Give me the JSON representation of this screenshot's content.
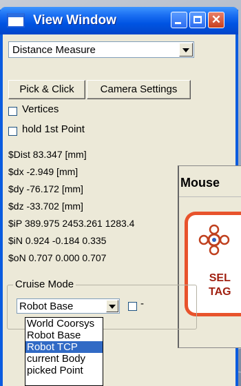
{
  "window": {
    "title": "View Window",
    "buttons": {
      "minimize_icon": "minimize-icon",
      "maximize_icon": "maximize-icon",
      "close_icon": "close-icon",
      "close_glyph": "✕"
    }
  },
  "measure": {
    "selected": "Distance Measure"
  },
  "buttons": {
    "pick_click": "Pick & Click",
    "camera_settings": "Camera Settings"
  },
  "options": {
    "vertices": "Vertices",
    "hold_first_point": "hold 1st Point"
  },
  "readouts": [
    "$Dist  83.347 [mm]",
    "$dx -2.949 [mm]",
    "$dy -76.172 [mm]",
    "$dz -33.702 [mm]",
    "$iP 389.975 2453.261 1283.4",
    "$iN 0.924 -0.184 0.335",
    "$oN 0.707 0.000 0.707"
  ],
  "cruise": {
    "label": "Cruise Mode",
    "selected": "Robot Base",
    "dash": "-",
    "options": [
      "World Coorsys",
      "Robot Base",
      "Robot TCP",
      "current Body",
      "picked Point"
    ],
    "highlighted_index": 2
  },
  "mouse_window": {
    "title": "Mouse",
    "tag_line1": "SEL",
    "tag_line2": "TAG"
  },
  "colors": {
    "title_bar": "#0054e3",
    "selection": "#316ac5",
    "panel_accent": "#e8532c"
  }
}
